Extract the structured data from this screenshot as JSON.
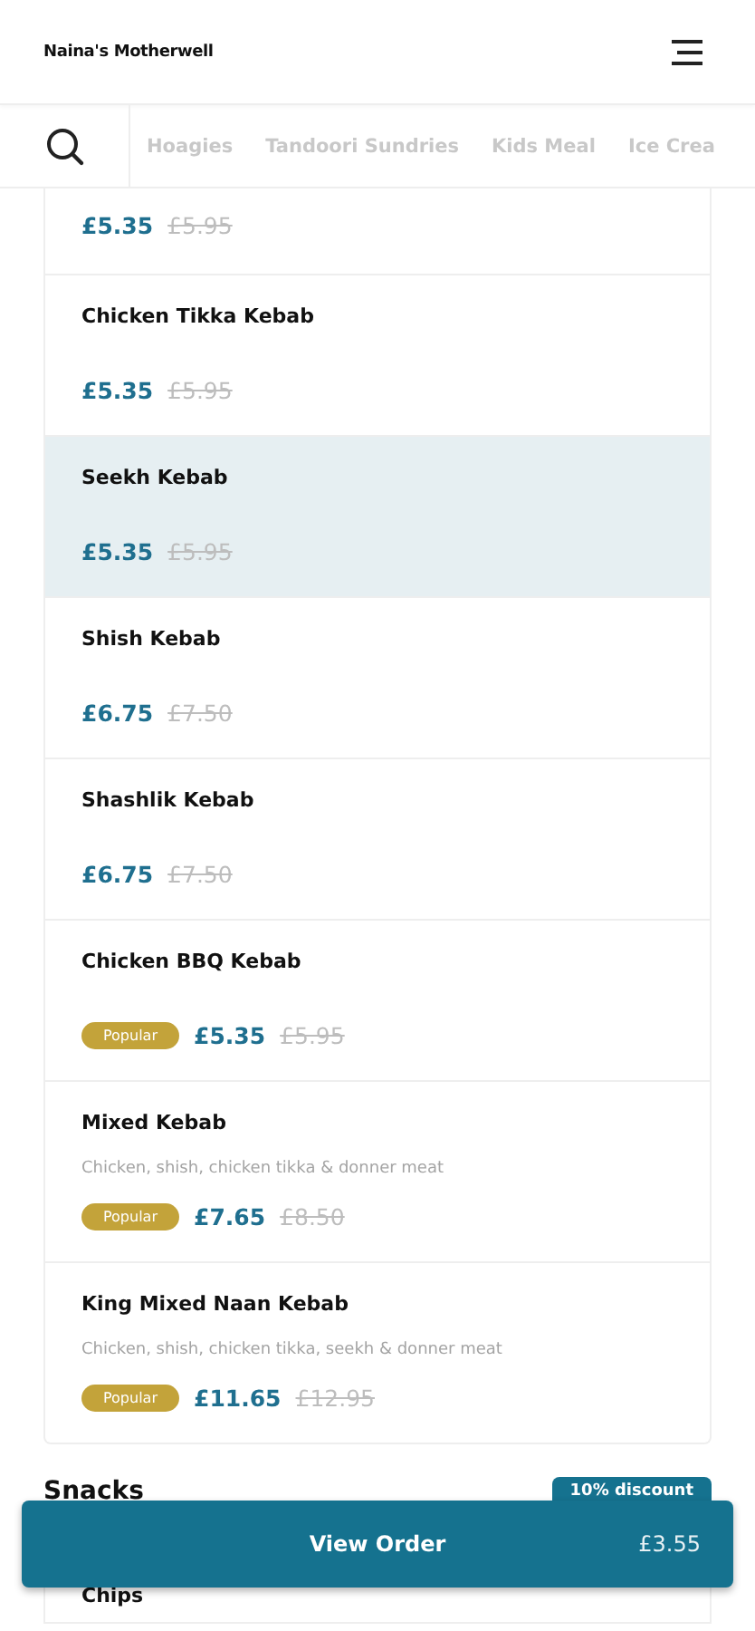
{
  "header": {
    "title": "Naina's Motherwell"
  },
  "categories": [
    {
      "label": "Hoagies",
      "selected": false
    },
    {
      "label": "Tandoori Sundries",
      "selected": false
    },
    {
      "label": "Kids Meal",
      "selected": false
    },
    {
      "label": "Ice Crea",
      "selected": false
    }
  ],
  "items": [
    {
      "price": "£5.35",
      "old_price": "£5.95",
      "selected": false
    },
    {
      "name": "Chicken Tikka Kebab",
      "price": "£5.35",
      "old_price": "£5.95",
      "selected": false
    },
    {
      "name": "Seekh Kebab",
      "price": "£5.35",
      "old_price": "£5.95",
      "selected": true
    },
    {
      "name": "Shish Kebab",
      "price": "£6.75",
      "old_price": "£7.50",
      "selected": false
    },
    {
      "name": "Shashlik Kebab",
      "price": "£6.75",
      "old_price": "£7.50",
      "selected": false
    },
    {
      "name": "Chicken BBQ Kebab",
      "badge": "Popular",
      "price": "£5.35",
      "old_price": "£5.95",
      "selected": false
    },
    {
      "name": "Mixed Kebab",
      "description": "Chicken, shish, chicken tikka & donner meat",
      "badge": "Popular",
      "price": "£7.65",
      "old_price": "£8.50",
      "selected": false
    },
    {
      "name": "King Mixed Naan Kebab",
      "description": "Chicken, shish, chicken tikka, seekh & donner meat",
      "badge": "Popular",
      "price": "£11.65",
      "old_price": "£12.95",
      "selected": false
    }
  ],
  "next_section": {
    "title": "Snacks",
    "discount": "10% discount",
    "items": [
      {
        "name": "Chips"
      }
    ]
  },
  "order_button": {
    "label": "View Order",
    "total": "£3.55"
  }
}
